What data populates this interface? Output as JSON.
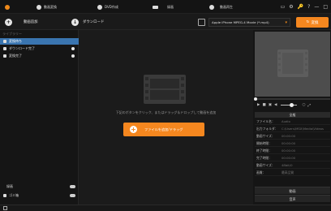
{
  "tabs": [
    {
      "label": "動画変換"
    },
    {
      "label": "DVD作成"
    },
    {
      "label": "録画"
    },
    {
      "label": "動画再生"
    }
  ],
  "window_controls": [
    "▭",
    "⚙",
    "🔑",
    "?",
    "—",
    "□"
  ],
  "toolbar": {
    "add_video_label": "動画追加",
    "download_label": "ダウンロード",
    "output_format": "Apple iPhone MPEG-4 Movie (*.mp4)",
    "convert_label": "変換"
  },
  "sidebar": {
    "header": "ライブラリー",
    "items": [
      {
        "label": "変換待ち"
      },
      {
        "label": "ダウンロード完了"
      },
      {
        "label": "変換完了"
      }
    ],
    "bottom_items": [
      {
        "label": "録画"
      },
      {
        "label": "ゴミ箱"
      }
    ]
  },
  "main": {
    "hint": "下記のボタンをクリック、またはドラッグ＆ドロップして動画を追加",
    "add_button_label": "ファイルを追加/ドラッグ"
  },
  "info": {
    "header": "全般",
    "rows": [
      {
        "key": "ファイル名：",
        "value": "Audio"
      },
      {
        "key": "出力フォルダ：",
        "value": "C:\\Users\\MSX\\Media\\Videos"
      },
      {
        "key": "動画サイズ：",
        "value": "00:00:00"
      },
      {
        "key": "開始時間：",
        "value": "00:00:00"
      },
      {
        "key": "終了時間：",
        "value": "00:00:00"
      },
      {
        "key": "完了時間：",
        "value": "00:00:00"
      },
      {
        "key": "動画サイズ：",
        "value": "48bit/0"
      },
      {
        "key": "画質：",
        "value": "最高品質"
      }
    ],
    "tabs": [
      {
        "label": "動画"
      },
      {
        "label": "音声"
      }
    ]
  },
  "colors": {
    "accent": "#f5871f",
    "selection": "#3a75b0",
    "background": "#1b1b1b"
  }
}
